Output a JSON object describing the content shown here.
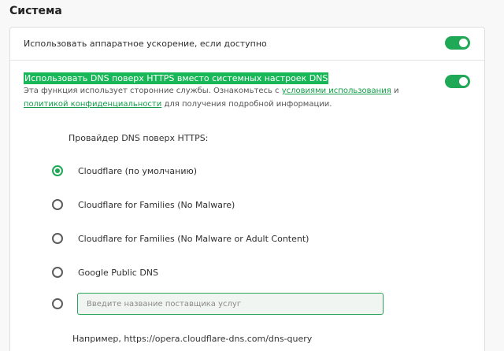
{
  "section": {
    "title": "Система"
  },
  "hardware_acceleration": {
    "label": "Использовать аппаратное ускорение, если доступно",
    "enabled": true
  },
  "dns_over_https": {
    "label": "Использовать DNS поверх HTTPS вместо системных настроек DNS",
    "enabled": true,
    "description_part1": "Эта функция использует сторонние службы. Ознакомьтесь с",
    "terms_link": "условиями использования",
    "description_and": "и",
    "privacy_link": "политикой конфиденциальности",
    "description_part2": "для получения подробной информации.",
    "provider_title": "Провайдер DNS поверх HTTPS:",
    "providers": [
      {
        "label": "Cloudflare (по умолчанию)",
        "selected": true
      },
      {
        "label": "Cloudflare for Families (No Malware)",
        "selected": false
      },
      {
        "label": "Cloudflare for Families (No Malware or Adult Content)",
        "selected": false
      },
      {
        "label": "Google Public DNS",
        "selected": false
      }
    ],
    "custom_placeholder": "Введите название поставщика услуг",
    "custom_value": "",
    "example": "Например, https://opera.cloudflare-dns.com/dns-query"
  },
  "colors": {
    "accent": "#1fa855",
    "highlight": "#18b858",
    "link": "#129c48"
  }
}
